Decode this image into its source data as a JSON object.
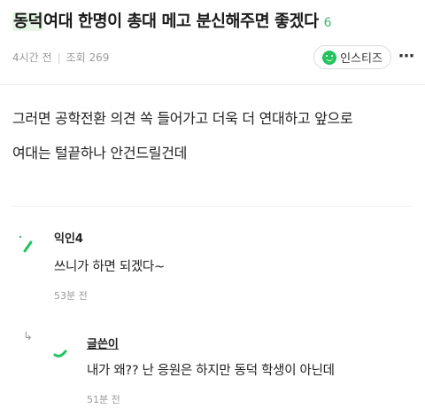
{
  "post": {
    "title_highlight": "동덕",
    "title_rest": "여대 한명이 총대 메고 분신해주면 좋겠다",
    "comment_count": "6",
    "time": "4시간 전",
    "views": "조회 269",
    "board_name": "인스티즈",
    "more_icon": "⋯",
    "body_lines": [
      "그러면 공학전환 의견 쏙 들어가고 더욱 더 연대하고 앞으로",
      "여대는 털끝하나 안건드릴건데"
    ]
  },
  "comments": [
    {
      "author": "익인4",
      "text": "쓰니가 하면 되겠다~",
      "time": "53분 전"
    }
  ],
  "replies": [
    {
      "reply_icon": "↳",
      "author": "글쓴이",
      "text": "내가 왜?? 난 응원은 하지만 동덕 학생이 아닌데",
      "time": "51분 전"
    }
  ],
  "colors": {
    "accent": "#3cb96a",
    "highlight": "#e6f6e6",
    "meta": "#9a9a9a"
  }
}
